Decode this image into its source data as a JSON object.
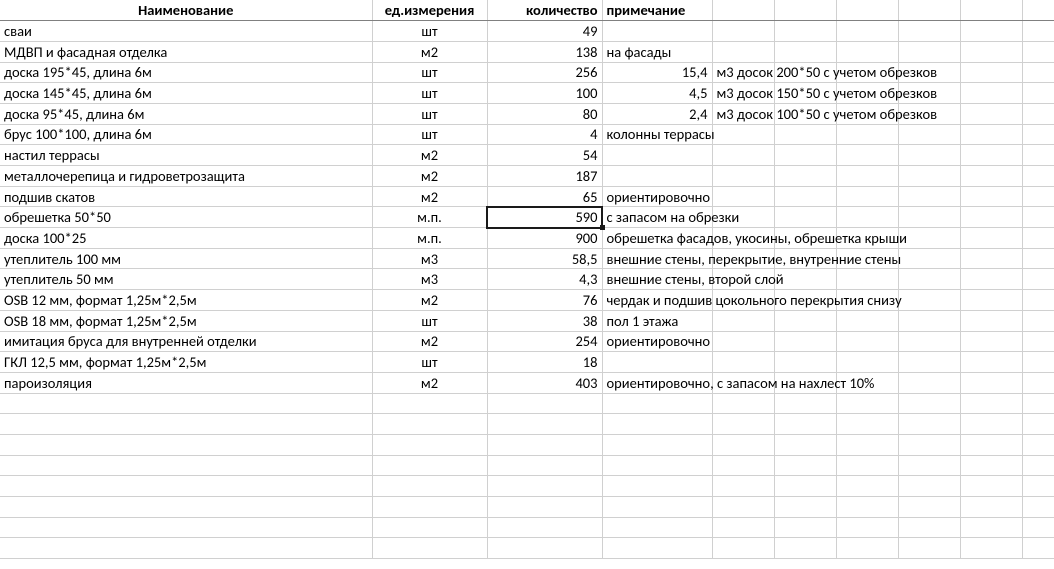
{
  "headers": {
    "name": "Наименование",
    "unit": "ед.измерения",
    "qty": "количество",
    "note": "примечание"
  },
  "rows": [
    {
      "name": "сваи",
      "unit": "шт",
      "qty": "49",
      "noteD": "",
      "noteE": ""
    },
    {
      "name": "МДВП и фасадная отделка",
      "unit": "м2",
      "qty": "138",
      "noteD": "на фасады",
      "noteE": ""
    },
    {
      "name": "доска 195*45, длина 6м",
      "unit": "шт",
      "qty": "256",
      "noteD": "15,4",
      "noteDnum": true,
      "noteE": "м3 досок 200*50 с учетом обрезков"
    },
    {
      "name": "доска 145*45, длина 6м",
      "unit": "шт",
      "qty": "100",
      "noteD": "4,5",
      "noteDnum": true,
      "noteE": "м3 досок 150*50 с учетом обрезков"
    },
    {
      "name": "доска 95*45, длина 6м",
      "unit": "шт",
      "qty": "80",
      "noteD": "2,4",
      "noteDnum": true,
      "noteE": "м3 досок 100*50 с учетом обрезков"
    },
    {
      "name": "брус 100*100, длина 6м",
      "unit": "шт",
      "qty": "4",
      "noteD": "колонны террасы",
      "noteE": ""
    },
    {
      "name": "настил террасы",
      "unit": "м2",
      "qty": "54",
      "noteD": "",
      "noteE": ""
    },
    {
      "name": "металлочерепица и гидроветрозащита",
      "unit": "м2",
      "qty": "187",
      "noteD": "",
      "noteE": ""
    },
    {
      "name": "подшив скатов",
      "unit": "м2",
      "qty": "65",
      "noteD": "ориентировочно",
      "noteE": ""
    },
    {
      "name": "обрешетка 50*50",
      "unit": "м.п.",
      "qty": "590",
      "noteD": "с запасом на обрезки",
      "noteE": "",
      "activeRow": true,
      "activeQty": true
    },
    {
      "name": "доска 100*25",
      "unit": "м.п.",
      "qty": "900",
      "noteD": "обрешетка фасадов, укосины, обрешетка крыши",
      "noteE": ""
    },
    {
      "name": "утеплитель 100 мм",
      "unit": "м3",
      "qty": "58,5",
      "noteD": "внешние стены, перекрытие, внутренние стены",
      "noteE": ""
    },
    {
      "name": "утеплитель 50 мм",
      "unit": "м3",
      "qty": "4,3",
      "noteD": "внешние стены, второй слой",
      "noteE": ""
    },
    {
      "name": "OSB 12 мм, формат 1,25м*2,5м",
      "unit": "м2",
      "qty": "76",
      "noteD": "чердак и подшив цокольного перекрытия снизу",
      "noteE": ""
    },
    {
      "name": "OSB 18 мм, формат 1,25м*2,5м",
      "unit": "шт",
      "qty": "38",
      "noteD": "пол 1 этажа",
      "noteE": ""
    },
    {
      "name": "имитация бруса для внутренней отделки",
      "unit": "м2",
      "qty": "254",
      "noteD": "ориентировочно",
      "noteE": ""
    },
    {
      "name": "ГКЛ 12,5 мм, формат 1,25м*2,5м",
      "unit": "шт",
      "qty": "18",
      "noteD": "",
      "noteE": ""
    },
    {
      "name": "пароизоляция",
      "unit": "м2",
      "qty": "403",
      "noteD": "ориентировочно, с запасом на нахлест 10%",
      "noteE": ""
    }
  ],
  "emptyRows": 8,
  "chart_data": {
    "type": "table",
    "columns": [
      "Наименование",
      "ед.измерения",
      "количество",
      "примечание"
    ],
    "data": [
      [
        "сваи",
        "шт",
        49,
        ""
      ],
      [
        "МДВП и фасадная отделка",
        "м2",
        138,
        "на фасады"
      ],
      [
        "доска 195*45, длина 6м",
        "шт",
        256,
        "15,4 м3 досок 200*50 с учетом обрезков"
      ],
      [
        "доска 145*45, длина 6м",
        "шт",
        100,
        "4,5 м3 досок 150*50 с учетом обрезков"
      ],
      [
        "доска 95*45, длина 6м",
        "шт",
        80,
        "2,4 м3 досок 100*50 с учетом обрезков"
      ],
      [
        "брус 100*100, длина 6м",
        "шт",
        4,
        "колонны террасы"
      ],
      [
        "настил террасы",
        "м2",
        54,
        ""
      ],
      [
        "металлочерепица и гидроветрозащита",
        "м2",
        187,
        ""
      ],
      [
        "подшив скатов",
        "м2",
        65,
        "ориентировочно"
      ],
      [
        "обрешетка 50*50",
        "м.п.",
        590,
        "с запасом на обрезки"
      ],
      [
        "доска 100*25",
        "м.п.",
        900,
        "обрешетка фасадов, укосины, обрешетка крыши"
      ],
      [
        "утеплитель 100 мм",
        "м3",
        58.5,
        "внешние стены, перекрытие, внутренние стены"
      ],
      [
        "утеплитель 50 мм",
        "м3",
        4.3,
        "внешние стены, второй слой"
      ],
      [
        "OSB 12 мм, формат 1,25м*2,5м",
        "м2",
        76,
        "чердак и подшив цокольного перекрытия снизу"
      ],
      [
        "OSB 18 мм, формат 1,25м*2,5м",
        "шт",
        38,
        "пол 1 этажа"
      ],
      [
        "имитация бруса для внутренней отделки",
        "м2",
        254,
        "ориентировочно"
      ],
      [
        "ГКЛ 12,5 мм, формат 1,25м*2,5м",
        "шт",
        18,
        ""
      ],
      [
        "пароизоляция",
        "м2",
        403,
        "ориентировочно, с запасом на нахлест 10%"
      ]
    ]
  }
}
